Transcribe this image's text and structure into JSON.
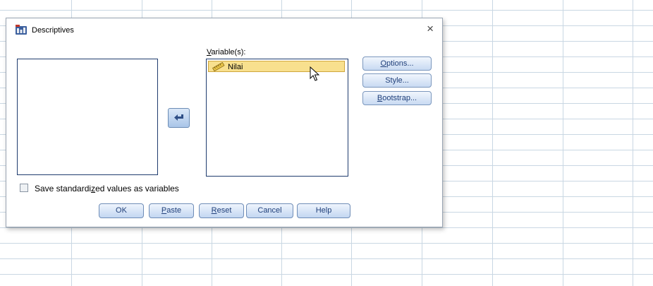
{
  "dialog": {
    "title": "Descriptives",
    "close_glyph": "×",
    "variables_label_underlined": "V",
    "variables_label_rest": "ariable(s):",
    "variables": [
      {
        "name": "Nilai",
        "icon": "scale-ruler-icon"
      }
    ],
    "options_underlined": "O",
    "options_rest": "ptions...",
    "style_label": "Style...",
    "bootstrap_underlined": "B",
    "bootstrap_rest": "ootstrap...",
    "save_label_pre": "Save standardi",
    "save_label_underlined": "z",
    "save_label_post": "ed values as variables",
    "save_checked": false,
    "ok_label": "OK",
    "paste_underlined": "P",
    "paste_rest": "aste",
    "reset_underlined": "R",
    "reset_rest": "eset",
    "cancel_label": "Cancel",
    "help_label": "Help"
  },
  "colors": {
    "selection": "#f8e08e",
    "button_text": "#1f3f7a",
    "list_border": "#1f3c6e"
  }
}
